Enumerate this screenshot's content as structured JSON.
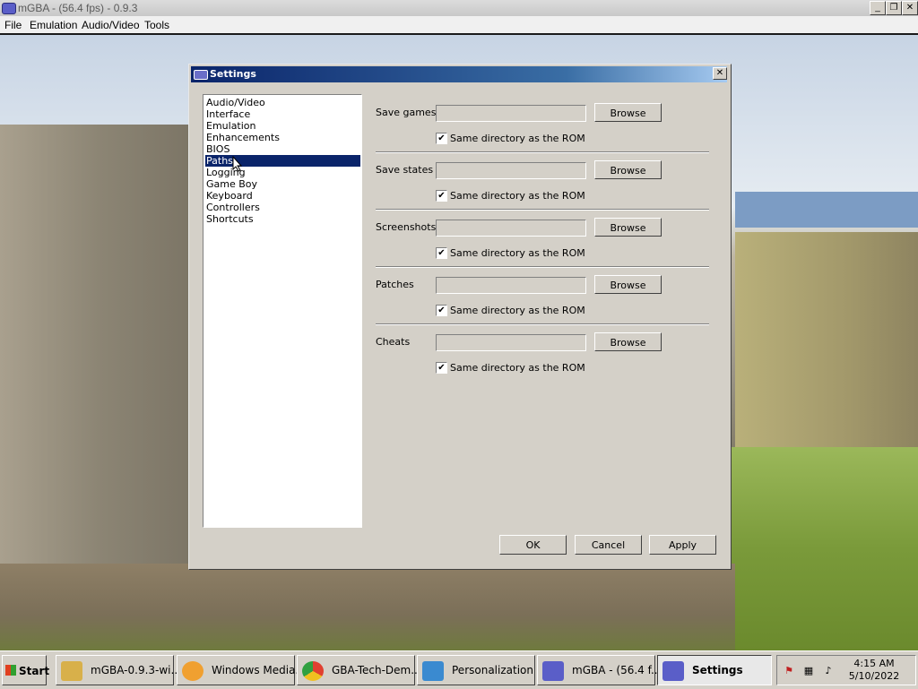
{
  "window": {
    "title": "mGBA -  (56.4 fps) - 0.9.3",
    "minimize": "_",
    "restore": "❐",
    "close": "✕"
  },
  "menu": [
    "File",
    "Emulation",
    "Audio/Video",
    "Tools"
  ],
  "dialog": {
    "title": "Settings",
    "close": "✕",
    "categories": [
      "Audio/Video",
      "Interface",
      "Emulation",
      "Enhancements",
      "BIOS",
      "Paths",
      "Logging",
      "Game Boy",
      "Keyboard",
      "Controllers",
      "Shortcuts"
    ],
    "selected": "Paths",
    "paths": [
      {
        "label": "Save games",
        "value": "",
        "browse": "Browse",
        "checkbox": "Same directory as the ROM",
        "checked": true
      },
      {
        "label": "Save states",
        "value": "",
        "browse": "Browse",
        "checkbox": "Same directory as the ROM",
        "checked": true
      },
      {
        "label": "Screenshots",
        "value": "",
        "browse": "Browse",
        "checkbox": "Same directory as the ROM",
        "checked": true
      },
      {
        "label": "Patches",
        "value": "",
        "browse": "Browse",
        "checkbox": "Same directory as the ROM",
        "checked": true
      },
      {
        "label": "Cheats",
        "value": "",
        "browse": "Browse",
        "checkbox": "Same directory as the ROM",
        "checked": true
      }
    ],
    "check_mark": "✔",
    "buttons": {
      "ok": "OK",
      "cancel": "Cancel",
      "apply": "Apply"
    }
  },
  "taskbar": {
    "start": "Start",
    "tasks": [
      {
        "label": "mGBA-0.9.3-wi...",
        "icon": "folder-icon",
        "color": "#d8b04a"
      },
      {
        "label": "Windows Media...",
        "icon": "media-player-icon",
        "color": "#f0a030"
      },
      {
        "label": "GBA-Tech-Dem...",
        "icon": "chrome-icon",
        "color": "#e04030"
      },
      {
        "label": "Personalization",
        "icon": "display-icon",
        "color": "#3a8ad0"
      },
      {
        "label": "mGBA -  (56.4 f...",
        "icon": "mgba-icon",
        "color": "#5a5ec8"
      },
      {
        "label": "Settings",
        "icon": "mgba-icon",
        "color": "#5a5ec8"
      }
    ],
    "clock_time": "4:15 AM",
    "clock_date": "5/10/2022"
  }
}
